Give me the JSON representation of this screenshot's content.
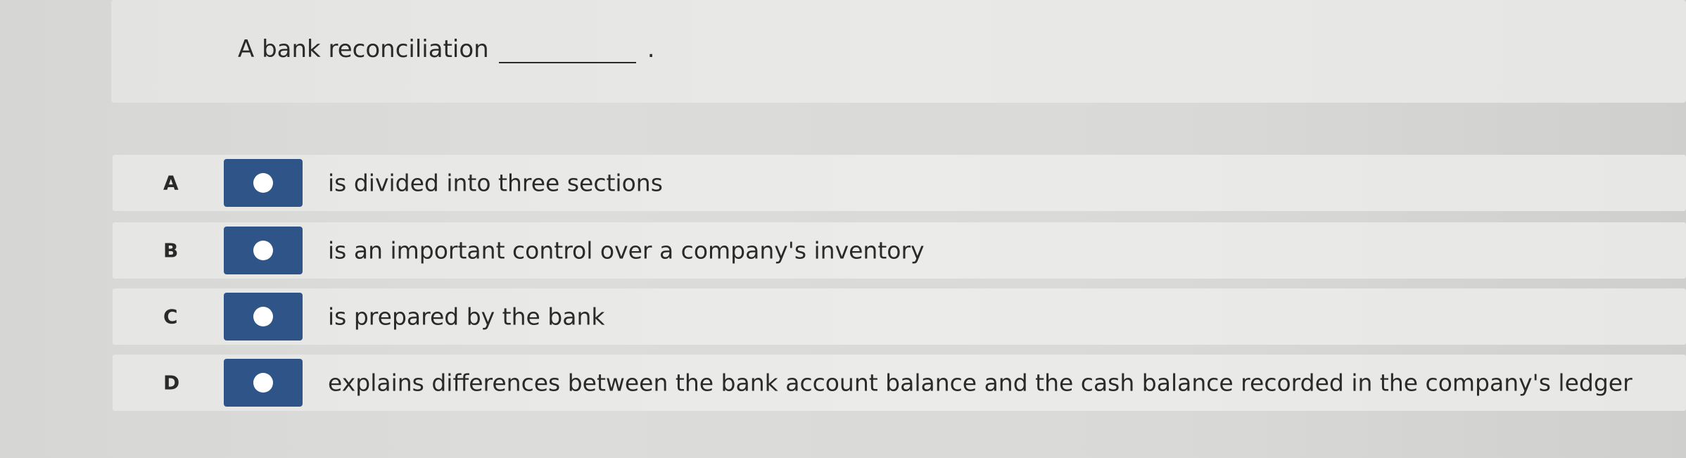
{
  "question": {
    "text": "A bank reconciliation",
    "trailing_punctuation": "."
  },
  "options": [
    {
      "letter": "A",
      "text": "is divided into three sections"
    },
    {
      "letter": "B",
      "text": "is an important control over a company's inventory"
    },
    {
      "letter": "C",
      "text": "is prepared by the bank"
    },
    {
      "letter": "D",
      "text": "explains differences between the bank account balance and the cash balance recorded in the company's ledger"
    }
  ],
  "colors": {
    "radio_button": "#2f5487",
    "radio_dot": "#ffffff",
    "text": "#2a2a2a"
  },
  "icons": {
    "radio": "radio-button-icon"
  }
}
